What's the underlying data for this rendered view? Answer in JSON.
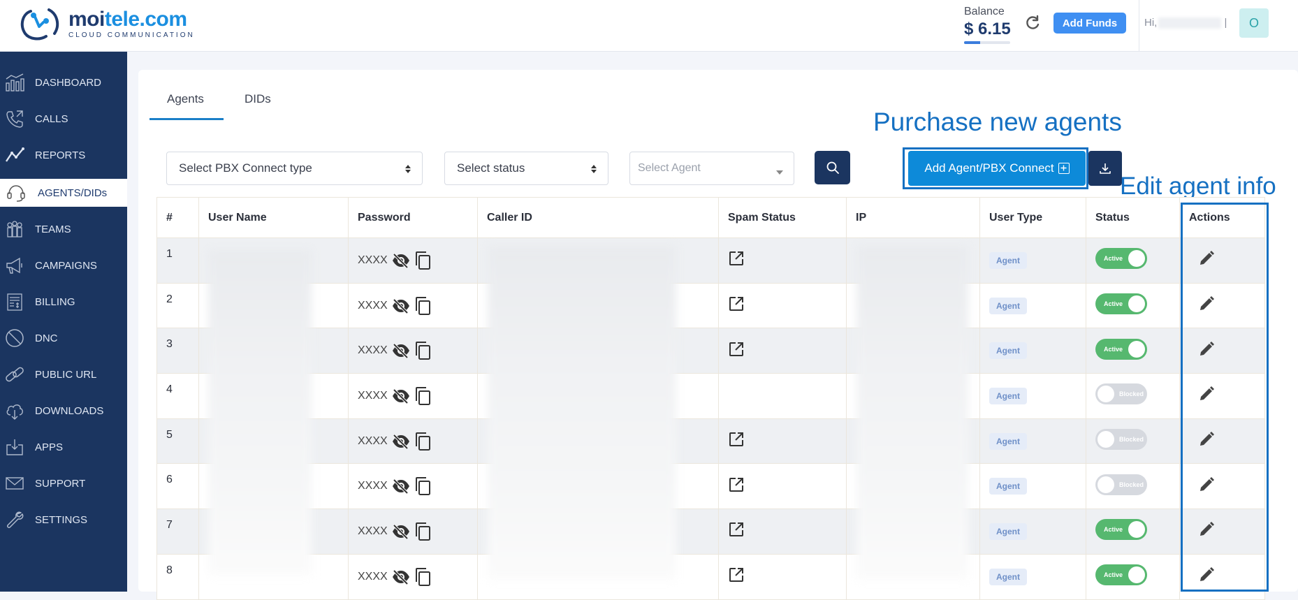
{
  "brand": {
    "name_part1": "moi",
    "name_part2": "tele.com",
    "tagline": "CLOUD COMMUNICATION"
  },
  "header": {
    "balance_label": "Balance",
    "balance_amount": "$ 6.15",
    "add_funds_label": "Add Funds",
    "greeting": "Hi,",
    "avatar_initial": "O"
  },
  "sidebar": {
    "items": [
      {
        "label": "DASHBOARD",
        "icon": "dashboard-icon"
      },
      {
        "label": "CALLS",
        "icon": "phone-icon"
      },
      {
        "label": "REPORTS",
        "icon": "chart-icon"
      },
      {
        "label": "AGENTS/DIDs",
        "icon": "headset-icon",
        "active": true
      },
      {
        "label": "TEAMS",
        "icon": "team-icon"
      },
      {
        "label": "CAMPAIGNS",
        "icon": "megaphone-icon"
      },
      {
        "label": "BILLING",
        "icon": "billing-icon"
      },
      {
        "label": "DNC",
        "icon": "block-icon"
      },
      {
        "label": "PUBLIC URL",
        "icon": "link-icon"
      },
      {
        "label": "DOWNLOADS",
        "icon": "cloud-download-icon"
      },
      {
        "label": "APPS",
        "icon": "apps-icon"
      },
      {
        "label": "SUPPORT",
        "icon": "mail-icon"
      },
      {
        "label": "SETTINGS",
        "icon": "wrench-icon"
      }
    ]
  },
  "tabs": [
    {
      "label": "Agents",
      "active": true
    },
    {
      "label": "DIDs"
    }
  ],
  "filters": {
    "pbx_type": "Select PBX Connect type",
    "status": "Select status",
    "agent_placeholder": "Select Agent"
  },
  "actions": {
    "add_agent_label": "Add Agent/PBX Connect"
  },
  "annotations": {
    "purchase": "Purchase new agents",
    "edit": "Edit agent info"
  },
  "table": {
    "columns": [
      "#",
      "User Name",
      "Password",
      "Caller ID",
      "Spam Status",
      "IP",
      "User Type",
      "Status",
      "Actions"
    ],
    "rows": [
      {
        "num": "1",
        "password": "XXXX",
        "spam": true,
        "type": "Agent",
        "status": "Active"
      },
      {
        "num": "2",
        "password": "XXXX",
        "spam": true,
        "type": "Agent",
        "status": "Active"
      },
      {
        "num": "3",
        "password": "XXXX",
        "spam": true,
        "type": "Agent",
        "status": "Active"
      },
      {
        "num": "4",
        "password": "XXXX",
        "spam": false,
        "type": "Agent",
        "status": "Blocked"
      },
      {
        "num": "5",
        "password": "XXXX",
        "spam": true,
        "type": "Agent",
        "status": "Blocked"
      },
      {
        "num": "6",
        "password": "XXXX",
        "spam": true,
        "type": "Agent",
        "status": "Blocked"
      },
      {
        "num": "7",
        "password": "XXXX",
        "spam": true,
        "type": "Agent",
        "status": "Active"
      },
      {
        "num": "8",
        "password": "XXXX",
        "spam": true,
        "type": "Agent",
        "status": "Active"
      }
    ]
  },
  "colors": {
    "sidebar": "#1b3560",
    "primary": "#0d8ad9",
    "active_toggle": "#56b86f",
    "annotation": "#1570c2"
  }
}
